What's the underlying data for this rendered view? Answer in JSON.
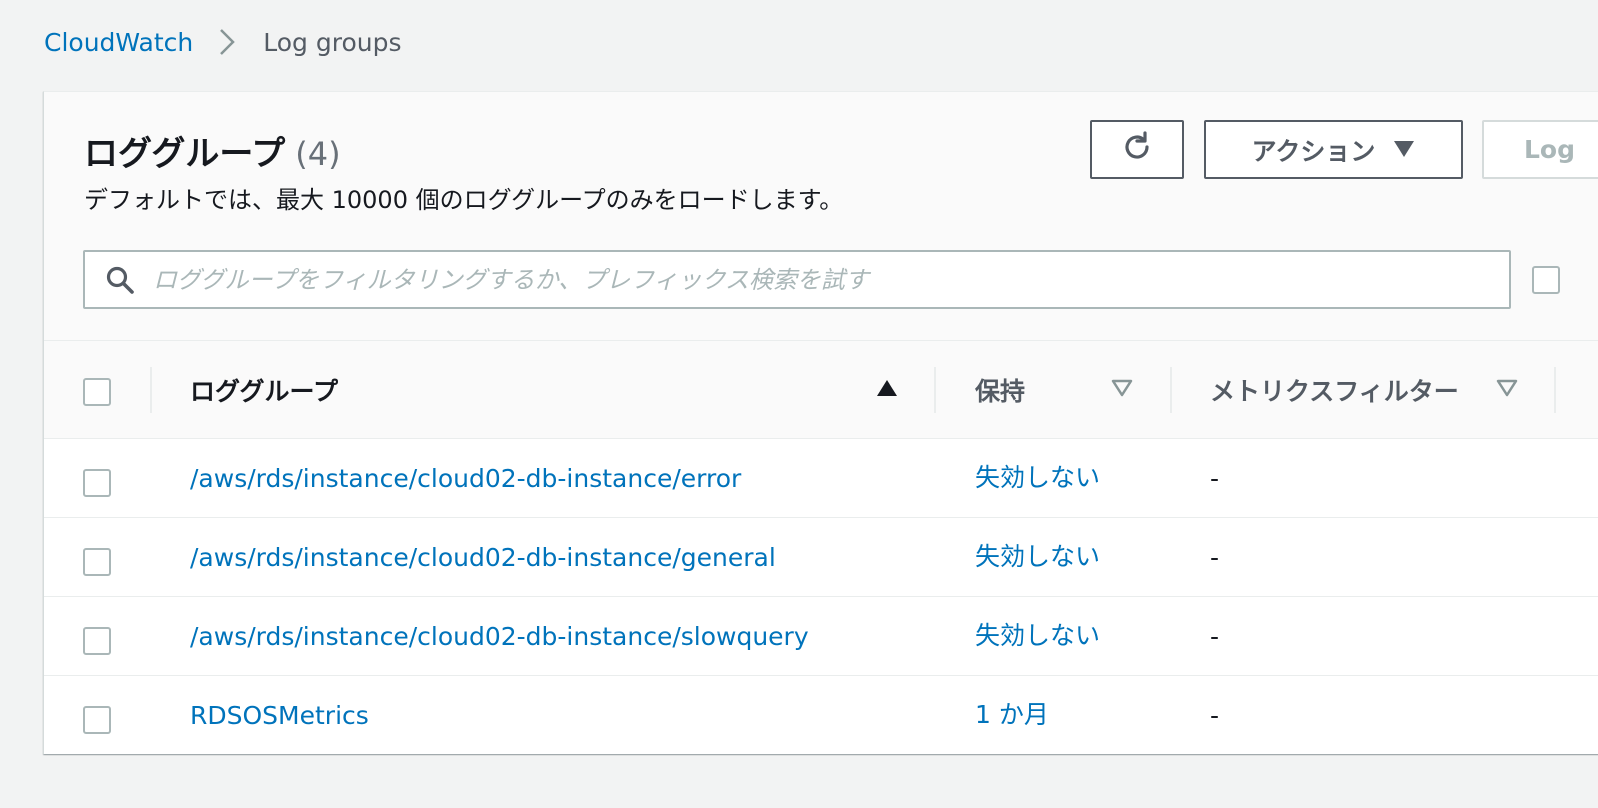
{
  "breadcrumb": {
    "root": "CloudWatch",
    "current": "Log groups"
  },
  "panel": {
    "title": "ロググループ",
    "count": "(4)",
    "description": "デフォルトでは、最大 10000 個のロググループのみをロードします。"
  },
  "toolbar": {
    "refresh_icon": "refresh-icon",
    "actions_label": "アクション",
    "actions_caret_icon": "caret-down-icon",
    "partial_button_label": "Log"
  },
  "search": {
    "placeholder": "ロググループをフィルタリングするか、プレフィックス検索を試す",
    "value": ""
  },
  "table": {
    "columns": {
      "log_group": "ロググループ",
      "retention": "保持",
      "metric_filter": "メトリクスフィルター"
    },
    "sort": {
      "log_group": "ascending-active",
      "retention": "unsorted",
      "metric_filter": "unsorted"
    },
    "rows": [
      {
        "name": "/aws/rds/instance/cloud02-db-instance/error",
        "retention": "失効しない",
        "metric_filter": "-"
      },
      {
        "name": "/aws/rds/instance/cloud02-db-instance/general",
        "retention": "失効しない",
        "metric_filter": "-"
      },
      {
        "name": "/aws/rds/instance/cloud02-db-instance/slowquery",
        "retention": "失効しない",
        "metric_filter": "-"
      },
      {
        "name": "RDSOSMetrics",
        "retention": "1 か月",
        "metric_filter": "-"
      }
    ]
  },
  "colors": {
    "link": "#0073bb",
    "text": "#16191f",
    "muted": "#545b64",
    "border": "#aab7b8",
    "background": "#f2f3f3"
  }
}
